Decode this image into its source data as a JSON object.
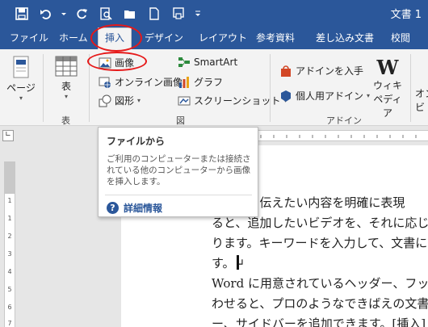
{
  "window": {
    "title": "文書 1"
  },
  "tabs": [
    {
      "label": "ファイル"
    },
    {
      "label": "ホーム"
    },
    {
      "label": "挿入"
    },
    {
      "label": "デザイン"
    },
    {
      "label": "レイアウト"
    },
    {
      "label": "参考資料"
    },
    {
      "label": "差し込み文書"
    },
    {
      "label": "校閲"
    }
  ],
  "ribbon": {
    "page": {
      "label": "ページ"
    },
    "table": {
      "label": "表",
      "group_label": "表"
    },
    "illustrations": {
      "image": "画像",
      "online_image": "オンライン画像",
      "shapes": "図形",
      "smartart": "SmartArt",
      "graph": "グラフ",
      "screenshot": "スクリーンショット",
      "group_label": "図"
    },
    "addins": {
      "get_addins": "アドインを入手",
      "my_addins": "個人用アドイン",
      "wikipedia_line1": "ウィキ",
      "wikipedia_line2": "ペディア",
      "group_label": "アドイン"
    },
    "online": {
      "label_line1": "オン",
      "label_line2": "ビ"
    }
  },
  "tooltip": {
    "title": "ファイルから",
    "body": "ご利用のコンピューターまたは接続されている他のコンピューターから画像を挿入します。",
    "help_link": "詳細情報"
  },
  "document": {
    "lines": [
      "使うと、伝えたい内容を明確に表現",
      "ると、追加したいビデオを、それに応じた埋め",
      "ります。キーワードを入力して、文書に最適な",
      "す。↵",
      "Word に用意されているヘッダー、フッター、表",
      "わせると、プロのようなできばえの文書を作成",
      "ー、サイドバーを追加できます。[挿入] をク"
    ]
  },
  "ruler": {
    "vertical_marks": [
      "1",
      "1",
      "2",
      "3",
      "4",
      "5",
      "6",
      "7"
    ]
  },
  "colors": {
    "accent": "#2b579a",
    "highlight": "#e61919"
  }
}
